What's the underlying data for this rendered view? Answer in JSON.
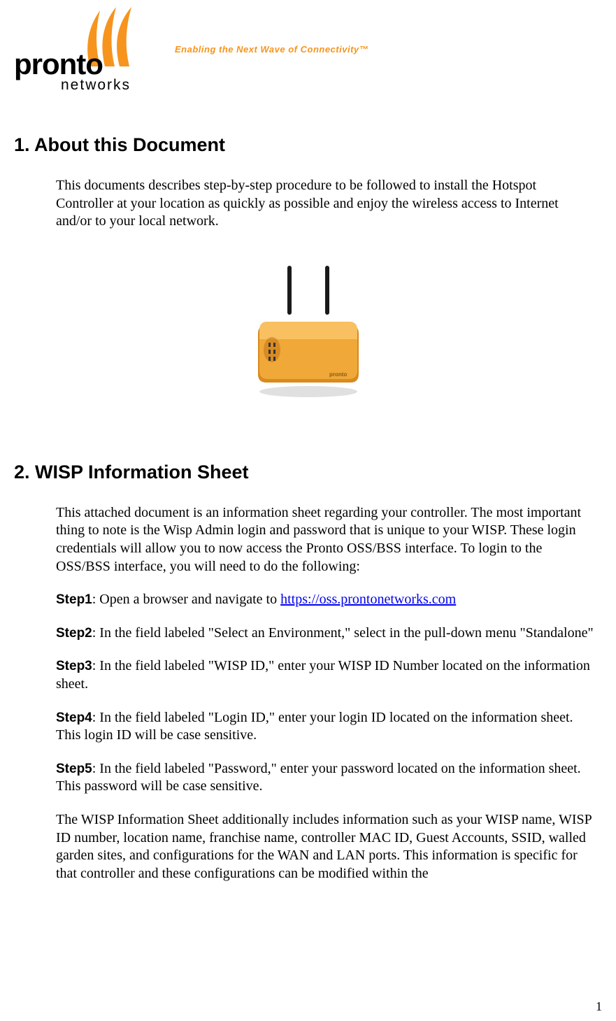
{
  "logo": {
    "line1": "pronto",
    "line2": "networks"
  },
  "tagline": "Enabling the Next Wave of Connectivity™",
  "section1": {
    "title": "1. About this Document",
    "para": "This documents describes step-by-step procedure to be followed to install the Hotspot Controller at your location as quickly as possible and enjoy the wireless access to Internet and/or to your local network."
  },
  "section2": {
    "title": "2. WISP Information Sheet",
    "intro": "This attached document is an information sheet regarding your controller. The most important thing to note is the Wisp Admin login and password that is unique to your WISP.  These login credentials will allow you to now access the Pronto OSS/BSS interface.  To login to the OSS/BSS interface, you will need to do the following:",
    "step1_label": "Step1",
    "step1_a": ":  Open a browser and navigate to ",
    "step1_link": "https://oss.prontonetworks.com",
    "step2_label": "Step2",
    "step2_text": ":  In the field labeled \"Select an Environment,\" select in the pull-down menu \"Standalone\"",
    "step3_label": "Step3",
    "step3_text": ":  In the field labeled \"WISP ID,\" enter your WISP ID Number located on the information sheet.",
    "step4_label": "Step4",
    "step4_text": ":  In the field labeled \"Login ID,\" enter your login ID located on the information sheet.  This login ID will be case sensitive.",
    "step5_label": "Step5",
    "step5_text": ":  In the field labeled \"Password,\" enter your password located on the information sheet.  This password will be case sensitive.",
    "closing": "The WISP Information Sheet additionally includes information such as your WISP name, WISP ID number, location name, franchise name, controller MAC ID, Guest Accounts, SSID, walled garden sites, and configurations for the WAN and LAN ports.  This information is specific for that controller and these configurations can be modified within the"
  },
  "page_number": "1"
}
